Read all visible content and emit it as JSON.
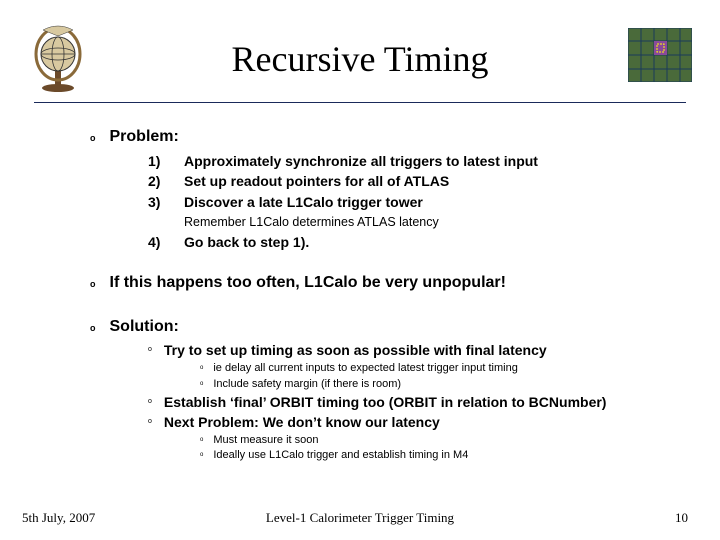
{
  "title": "Recursive Timing",
  "sections": {
    "problem": {
      "heading": "Problem:",
      "items": {
        "n1": {
          "num": "1)",
          "text": "Approximately synchronize all triggers to latest input"
        },
        "n2": {
          "num": "2)",
          "text": "Set up readout pointers for all of ATLAS"
        },
        "n3": {
          "num": "3)",
          "text": "Discover a late L1Calo trigger tower"
        },
        "note": "Remember L1Calo determines ATLAS latency",
        "n4": {
          "num": "4)",
          "text": "Go back to step 1)."
        }
      }
    },
    "warning": "If this happens too often, L1Calo be very unpopular!",
    "solution": {
      "heading": "Solution:",
      "items": {
        "s1": "Try to set up timing as soon as possible with final latency",
        "s1a": "ie delay all current inputs to expected latest trigger input timing",
        "s1b": "Include safety margin (if there is room)",
        "s2": "Establish ‘final’ ORBIT timing too (ORBIT in relation to BCNumber)",
        "s3": "Next Problem: We don’t know our latency",
        "s3a": "Must measure it soon",
        "s3b": "Ideally use L1Calo trigger and establish timing in M4"
      }
    }
  },
  "footer": {
    "date": "5th July, 2007",
    "center": "Level-1 Calorimeter Trigger Timing",
    "page": "10"
  },
  "icons": {
    "atlas": "atlas-globe-icon",
    "calo": "calorimeter-grid-icon"
  }
}
